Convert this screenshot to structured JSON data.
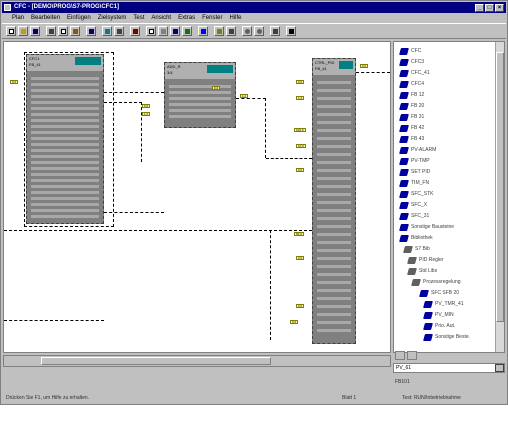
{
  "window": {
    "title": "CFC - [DEMO\\PROG\\S7-PROG\\CFC1]"
  },
  "menu": [
    "Plan",
    "Bearbeiten",
    "Einfügen",
    "Zielsystem",
    "Test",
    "Ansicht",
    "Extras",
    "Fenster",
    "Hilfe"
  ],
  "blocks": [
    {
      "title": "CFC1",
      "sub": "FB_41"
    },
    {
      "title": "ADD_R",
      "sub": "3/4"
    },
    {
      "title": "CTRL_PID",
      "sub": "FB_41"
    }
  ],
  "pins": {
    "left_in": "0.0",
    "mid_in1": "0.0",
    "mid_in2": "1.0",
    "mid_out": "1.0",
    "mid_outlabel": "0.0",
    "right_in": "0.0",
    "rin_a": "0.0",
    "rin_b": "1.0",
    "rin_c": "0.0",
    "rin_d": "100.0",
    "rin_e": "10.0",
    "rin_f": "0.0",
    "rin_g": "50.0",
    "rin_h": "2.0",
    "rin_i": "0.0"
  },
  "tree": {
    "items": [
      "CFC",
      "CFC3",
      "CFC_41",
      "CFC4",
      "FB 12",
      "FB 20",
      "FB 31",
      "FB 42",
      "FB 43",
      "PV-ALARM",
      "PV-TMP",
      "SET PID",
      "TIM_FN",
      "SFC_STK",
      "SFC_X",
      "SFC_31",
      "Sonstige Bausteine",
      "Bibliothek",
      "S7 Bib",
      "PID Regler",
      "Std Libs",
      "Prozessregelung",
      "SFC SFB 20",
      "PV_TMR_41",
      "PV_MIN",
      "Prio. Aut.",
      "Sonstige Beste."
    ],
    "selected": "Prio. Aut."
  },
  "search": {
    "value": "PV_61"
  },
  "footer_label": "FB101",
  "status": {
    "hint": "Drücken Sie F1, um Hilfe zu erhalten.",
    "page": "Blatt 1",
    "mode": "Test: RUN/Inbetriebnahme"
  }
}
